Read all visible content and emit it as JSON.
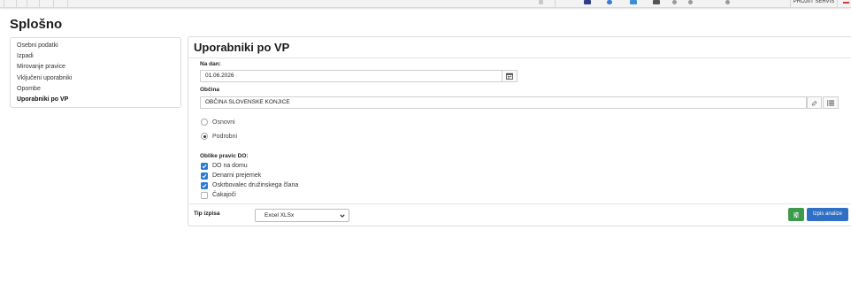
{
  "topbar": {
    "brand_label": "PROJIIT SERVIS"
  },
  "page": {
    "title": "Splošno"
  },
  "sidebar": {
    "items": [
      {
        "label": "Osebni podatki",
        "active": false
      },
      {
        "label": "Izpadi",
        "active": false
      },
      {
        "label": "Mirovanje pravice",
        "active": false
      },
      {
        "label": "Vključeni uporabniki",
        "active": false
      },
      {
        "label": "Opombe",
        "active": false
      },
      {
        "label": "Uporabniki po VP",
        "active": true
      }
    ]
  },
  "main": {
    "title": "Uporabniki po VP",
    "date_field": {
      "label": "Na dan:",
      "value": "01.06.2026"
    },
    "municipality_field": {
      "label": "Občina",
      "value": "OBČINA SLOVENSKE KONJICE"
    },
    "report_level": {
      "options": [
        {
          "label": "Osnovni",
          "selected": false
        },
        {
          "label": "Podrobni",
          "selected": true
        }
      ]
    },
    "forms": {
      "label": "Oblike pravic DO:",
      "options": [
        {
          "label": "DO na domu",
          "checked": true
        },
        {
          "label": "Denarni prejemek",
          "checked": true
        },
        {
          "label": "Oskrbovalec družinskega člana",
          "checked": true
        },
        {
          "label": "Čakajoči",
          "checked": false
        }
      ]
    },
    "output": {
      "label": "Tip izpisa",
      "selected": "Excel XLSx"
    },
    "run_button": "Izpis analize"
  },
  "colors": {
    "accent_blue": "#2f6fc4",
    "checkbox_blue": "#2a7bd4",
    "settings_green": "#3d9a4a"
  },
  "icons": {
    "date_picker": "calendar-icon",
    "clear": "eraser-icon",
    "list": "list-icon",
    "settings": "sliders-icon"
  }
}
